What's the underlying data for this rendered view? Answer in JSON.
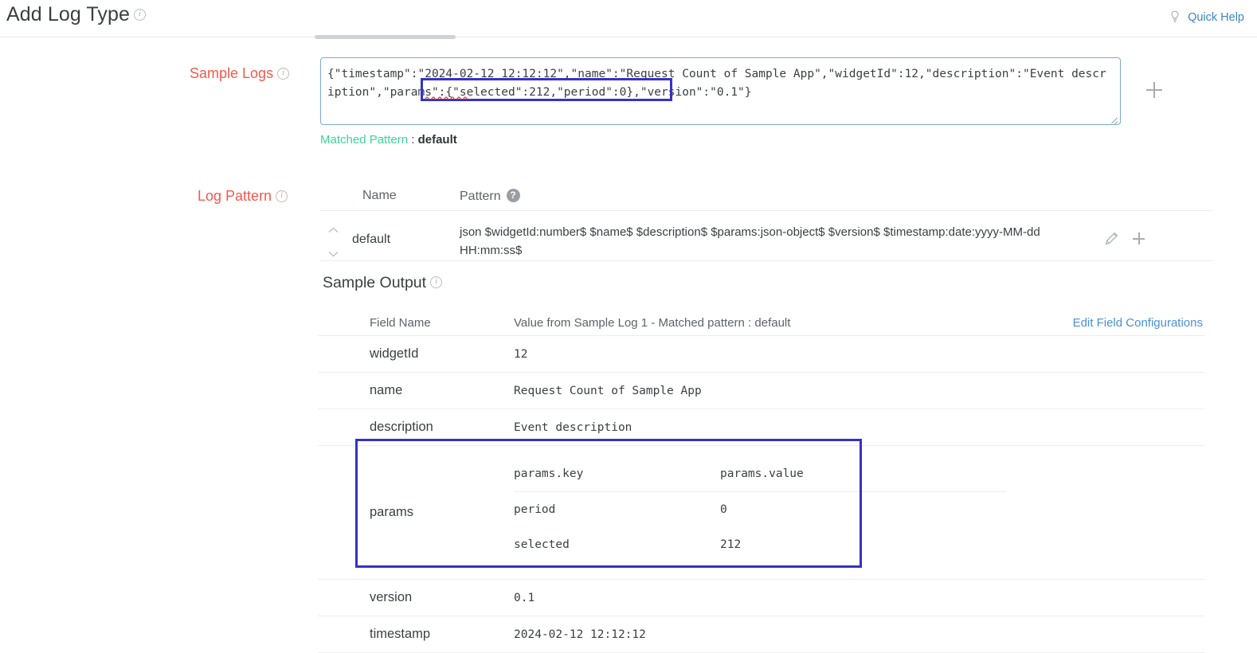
{
  "header": {
    "title": "Add Log Type",
    "info_icon": "info-icon",
    "quick_help": "Quick Help",
    "quick_help_icon": "lightbulb-icon",
    "quick_help_color": "#3d84cc"
  },
  "sample_logs": {
    "label": "Sample Logs",
    "value_part1": "{\"timestamp\":\"2024-02-12 12:12:12\",\"name\":\"Request Count of Sample App\",\"widgetId\":12,\"description\":\"Event description\",",
    "value_highlight": "\"params\":{\"selected\":212,\"period\":0",
    "value_part2": ",\"version\":\"0.1\"}",
    "full_value": "{\"timestamp\":\"2024-02-12 12:12:12\",\"name\":\"Request Count of Sample App\",\"widgetId\":12,\"description\":\"Event description\",\"params\":{\"selected\":212,\"period\":0},\"version\":\"0.1\"}",
    "add_icon": "plus-icon",
    "matched_pattern_label": "Matched Pattern",
    "matched_pattern_separator": " : ",
    "matched_pattern_value": "default",
    "matched_pattern_color": "#3bd39c",
    "annotation_color": "#3632c4"
  },
  "log_pattern": {
    "label": "Log Pattern",
    "columns": [
      "Name",
      "Pattern"
    ],
    "help_icon": "question-mark-icon",
    "rows": [
      {
        "name": "default",
        "pattern": "json $widgetId:number$ $name$ $description$ $params:json-object$ $version$ $timestamp:date:yyyy-MM-dd HH:mm:ss$",
        "move_up_icon": "chevron-up-icon",
        "move_down_icon": "chevron-down-icon",
        "edit_icon": "pencil-icon",
        "add_icon": "plus-icon"
      }
    ]
  },
  "sample_output": {
    "title": "Sample Output",
    "columns": {
      "field_name": "Field Name",
      "value": "Value from Sample Log 1 - Matched pattern : default",
      "edit_link": "Edit Field Configurations"
    },
    "rows": [
      {
        "field": "widgetId",
        "value": "12"
      },
      {
        "field": "name",
        "value": "Request Count of Sample App"
      },
      {
        "field": "description",
        "value": "Event description"
      }
    ],
    "params_row": {
      "field": "params",
      "nested_columns": [
        "params.key",
        "params.value"
      ],
      "nested_rows": [
        {
          "key": "period",
          "value": "0"
        },
        {
          "key": "selected",
          "value": "212"
        }
      ]
    },
    "rows_after": [
      {
        "field": "version",
        "value": "0.1"
      },
      {
        "field": "timestamp",
        "value": "2024-02-12 12:12:12"
      }
    ]
  }
}
